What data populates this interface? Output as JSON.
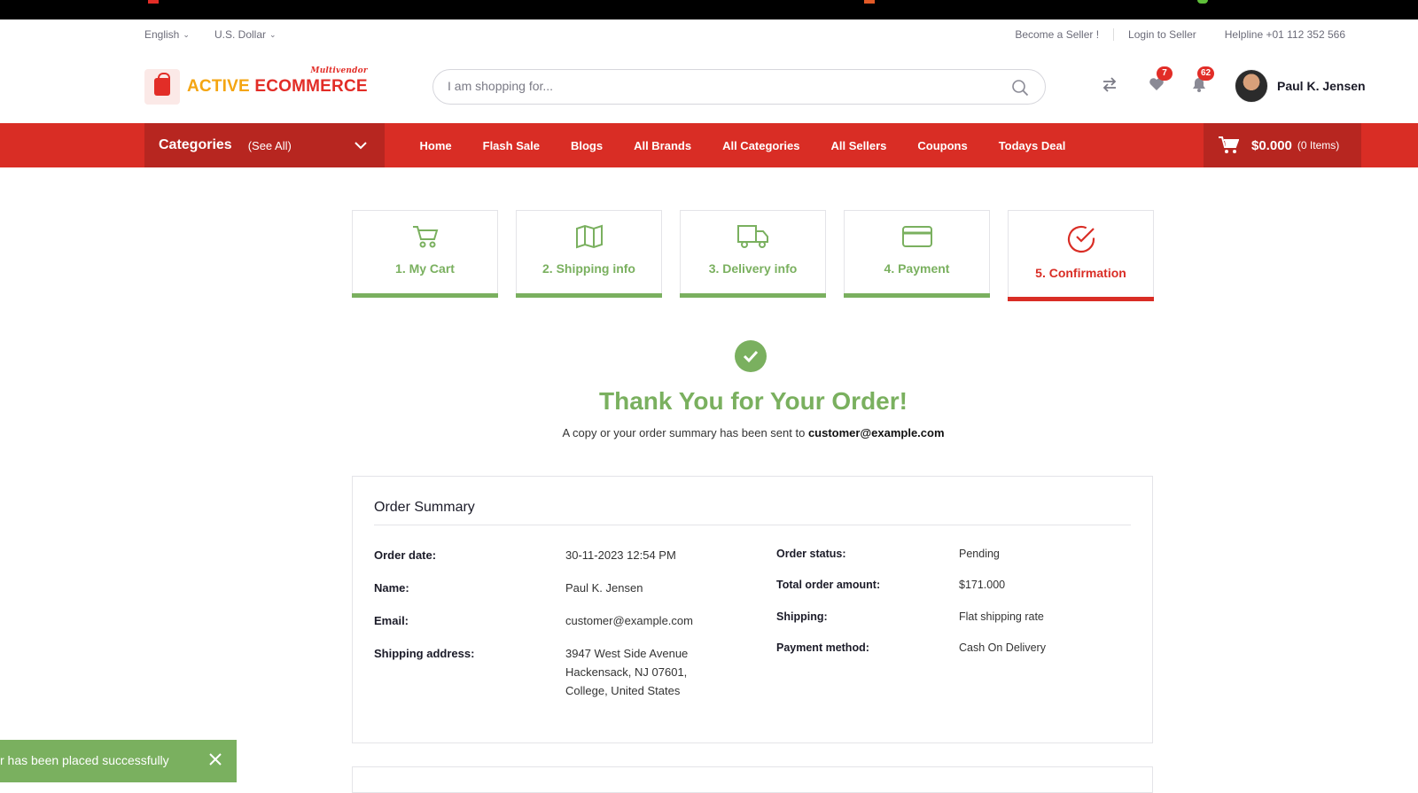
{
  "topbar": {
    "language": "English",
    "currency": "U.S. Dollar",
    "become_seller": "Become a Seller !",
    "login_seller": "Login to Seller",
    "helpline": "Helpline +01 112 352 566"
  },
  "brand": {
    "name_part1": "ACTIVE",
    "name_part2": "ECOMMERCE",
    "tagline": "Multivendor",
    "accent": "#d92d25",
    "success": "#7ab05f"
  },
  "search": {
    "placeholder": "I am shopping for..."
  },
  "header_icons": {
    "wishlist_count": "7",
    "notification_count": "62"
  },
  "user": {
    "name": "Paul K. Jensen"
  },
  "nav": {
    "categories_title": "Categories",
    "categories_see_all": "(See All)",
    "links": [
      "Home",
      "Flash Sale",
      "Blogs",
      "All Brands",
      "All Categories",
      "All Sellers",
      "Coupons",
      "Todays Deal"
    ],
    "cart_amount": "$0.000",
    "cart_items": "(0 Items)"
  },
  "steps": [
    {
      "label": "1. My Cart",
      "icon": "cart-icon"
    },
    {
      "label": "2. Shipping info",
      "icon": "map-icon"
    },
    {
      "label": "3. Delivery info",
      "icon": "truck-icon"
    },
    {
      "label": "4. Payment",
      "icon": "credit-card-icon"
    },
    {
      "label": "5. Confirmation",
      "icon": "check-circle-icon"
    }
  ],
  "confirmation": {
    "title": "Thank You for Your Order!",
    "note_prefix": "A copy or your order summary has been sent to",
    "note_email": "customer@example.com"
  },
  "summary": {
    "heading": "Order Summary",
    "left": [
      {
        "label": "Order date:",
        "value": "30-11-2023 12:54 PM"
      },
      {
        "label": "Name:",
        "value": "Paul K. Jensen"
      },
      {
        "label": "Email:",
        "value": "customer@example.com"
      },
      {
        "label": "Shipping address:",
        "value_lines": [
          "3947 West Side Avenue",
          "Hackensack, NJ 07601,",
          "College, United States"
        ]
      }
    ],
    "right": [
      {
        "label": "Order status:",
        "value": "Pending"
      },
      {
        "label": "Total order amount:",
        "value": "$171.000"
      },
      {
        "label": "Shipping:",
        "value": "Flat shipping rate"
      },
      {
        "label": "Payment method:",
        "value": "Cash On Delivery"
      }
    ]
  },
  "toast": {
    "message": "r has been placed successfully"
  }
}
